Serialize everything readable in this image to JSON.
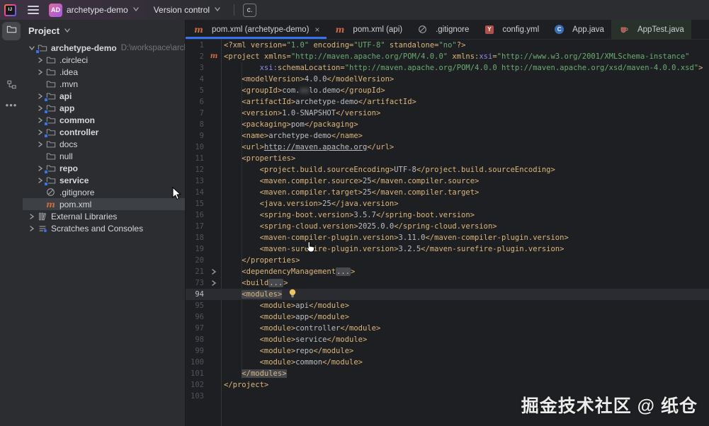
{
  "titlebar": {
    "project_badge": "AD",
    "project_name": "archetype-demo",
    "version_control_label": "Version control",
    "capture_badge": "c."
  },
  "stripe_icons": [
    "project-folder",
    "structure",
    "more-tool-windows"
  ],
  "project_panel": {
    "header": "Project",
    "tree": [
      {
        "label": "archetype-demo",
        "icon": "module-folder",
        "level": 0,
        "chevron": "expanded",
        "bold": true,
        "path": "D:\\workspace\\archetype-de"
      },
      {
        "label": ".circleci",
        "icon": "folder",
        "level": 1,
        "chevron": "collapsed"
      },
      {
        "label": ".idea",
        "icon": "folder",
        "level": 1,
        "chevron": "collapsed"
      },
      {
        "label": ".mvn",
        "icon": "folder",
        "level": 1,
        "chevron": "none"
      },
      {
        "label": "api",
        "icon": "module-folder",
        "level": 1,
        "chevron": "collapsed",
        "bold": true
      },
      {
        "label": "app",
        "icon": "module-folder",
        "level": 1,
        "chevron": "collapsed",
        "bold": true
      },
      {
        "label": "common",
        "icon": "module-folder",
        "level": 1,
        "chevron": "collapsed",
        "bold": true
      },
      {
        "label": "controller",
        "icon": "module-folder",
        "level": 1,
        "chevron": "collapsed",
        "bold": true
      },
      {
        "label": "docs",
        "icon": "folder",
        "level": 1,
        "chevron": "collapsed"
      },
      {
        "label": "null",
        "icon": "folder",
        "level": 1,
        "chevron": "none"
      },
      {
        "label": "repo",
        "icon": "module-folder",
        "level": 1,
        "chevron": "collapsed",
        "bold": true
      },
      {
        "label": "service",
        "icon": "module-folder",
        "level": 1,
        "chevron": "collapsed",
        "bold": true
      },
      {
        "label": ".gitignore",
        "icon": "ignored",
        "level": 1,
        "chevron": "none"
      },
      {
        "label": "pom.xml",
        "icon": "maven",
        "level": 1,
        "chevron": "none",
        "selected": true
      },
      {
        "label": "External Libraries",
        "icon": "libraries",
        "level": 0,
        "chevron": "collapsed"
      },
      {
        "label": "Scratches and Consoles",
        "icon": "scratches",
        "level": 0,
        "chevron": "collapsed"
      }
    ]
  },
  "tabs": [
    {
      "label": "pom.xml (archetype-demo)",
      "icon": "maven",
      "active": true,
      "closable": true
    },
    {
      "label": "pom.xml (api)",
      "icon": "maven"
    },
    {
      "label": ".gitignore",
      "icon": "ignored"
    },
    {
      "label": "config.yml",
      "icon": "yaml"
    },
    {
      "label": "App.java",
      "icon": "java-class"
    },
    {
      "label": "AppTest.java",
      "icon": "java-test",
      "tinted": true
    }
  ],
  "editor": {
    "lines": [
      {
        "n": "1",
        "seg": [
          [
            "tag",
            "<?xml version="
          ],
          [
            "str",
            "\"1.0\""
          ],
          [
            "tag",
            " encoding="
          ],
          [
            "str",
            "\"UTF-8\""
          ],
          [
            "tag",
            " standalone="
          ],
          [
            "str",
            "\"no\""
          ],
          [
            "tag",
            "?>"
          ]
        ]
      },
      {
        "n": "2",
        "g": "maven",
        "seg": [
          [
            "tag",
            "<project xmlns="
          ],
          [
            "str",
            "\"http://maven.apache.org/POM/4.0.0\""
          ],
          [
            "tag",
            " xmlns:"
          ],
          [
            "ns",
            "xsi"
          ],
          [
            "tag",
            "="
          ],
          [
            "str",
            "\"http://www.w3.org/2001/XMLSchema-instance\""
          ]
        ]
      },
      {
        "n": "3",
        "seg": [
          [
            "txt",
            "        "
          ],
          [
            "ns",
            "xsi:"
          ],
          [
            "tag",
            "schemaLocation="
          ],
          [
            "str",
            "\"http://maven.apache.org/POM/4.0.0 http://maven.apache.org/xsd/maven-4.0.0.xsd\""
          ],
          [
            "tag",
            ">"
          ]
        ]
      },
      {
        "n": "4",
        "seg": [
          [
            "txt",
            "    "
          ],
          [
            "tag",
            "<modelVersion>"
          ],
          [
            "txt",
            "4.0.0"
          ],
          [
            "tag",
            "</modelVersion>"
          ]
        ]
      },
      {
        "n": "5",
        "seg": [
          [
            "txt",
            "    "
          ],
          [
            "tag",
            "<groupId>"
          ],
          [
            "txt",
            "com."
          ],
          [
            "blur",
            "xx"
          ],
          [
            "txt",
            "lo.demo"
          ],
          [
            "tag",
            "</groupId>"
          ]
        ]
      },
      {
        "n": "6",
        "seg": [
          [
            "txt",
            "    "
          ],
          [
            "tag",
            "<artifactId>"
          ],
          [
            "txt",
            "archetype-demo"
          ],
          [
            "tag",
            "</artifactId>"
          ]
        ]
      },
      {
        "n": "7",
        "seg": [
          [
            "txt",
            "    "
          ],
          [
            "tag",
            "<version>"
          ],
          [
            "txt",
            "1.0-SNAPSHOT"
          ],
          [
            "tag",
            "</version>"
          ]
        ]
      },
      {
        "n": "8",
        "seg": [
          [
            "txt",
            "    "
          ],
          [
            "tag",
            "<packaging>"
          ],
          [
            "txt",
            "pom"
          ],
          [
            "tag",
            "</packaging>"
          ]
        ]
      },
      {
        "n": "9",
        "seg": [
          [
            "txt",
            "    "
          ],
          [
            "tag",
            "<name>"
          ],
          [
            "txt",
            "archetype-demo"
          ],
          [
            "tag",
            "</name>"
          ]
        ]
      },
      {
        "n": "10",
        "seg": [
          [
            "txt",
            "    "
          ],
          [
            "tag",
            "<url>"
          ],
          [
            "url",
            "http://maven.apache.org"
          ],
          [
            "tag",
            "</url>"
          ]
        ]
      },
      {
        "n": "11",
        "seg": [
          [
            "txt",
            "    "
          ],
          [
            "tag",
            "<properties>"
          ]
        ]
      },
      {
        "n": "12",
        "seg": [
          [
            "txt",
            "        "
          ],
          [
            "tag",
            "<project.build.sourceEncoding>"
          ],
          [
            "txt",
            "UTF-8"
          ],
          [
            "tag",
            "</project.build.sourceEncoding>"
          ]
        ]
      },
      {
        "n": "13",
        "seg": [
          [
            "txt",
            "        "
          ],
          [
            "tag",
            "<maven.compiler.source>"
          ],
          [
            "txt",
            "25"
          ],
          [
            "tag",
            "</maven.compiler.source>"
          ]
        ]
      },
      {
        "n": "14",
        "seg": [
          [
            "txt",
            "        "
          ],
          [
            "tag",
            "<maven.compiler.target>"
          ],
          [
            "txt",
            "25"
          ],
          [
            "tag",
            "</maven.compiler.target>"
          ]
        ]
      },
      {
        "n": "15",
        "seg": [
          [
            "txt",
            "        "
          ],
          [
            "tag",
            "<java.version>"
          ],
          [
            "txt",
            "25"
          ],
          [
            "tag",
            "</java.version>"
          ]
        ]
      },
      {
        "n": "16",
        "seg": [
          [
            "txt",
            "        "
          ],
          [
            "tag",
            "<spring-boot.version>"
          ],
          [
            "txt",
            "3.5.7"
          ],
          [
            "tag",
            "</spring-boot.version>"
          ]
        ]
      },
      {
        "n": "17",
        "seg": [
          [
            "txt",
            "        "
          ],
          [
            "tag",
            "<spring-cloud.version>"
          ],
          [
            "txt",
            "2025.0.0"
          ],
          [
            "tag",
            "</spring-cloud.version>"
          ]
        ]
      },
      {
        "n": "18",
        "seg": [
          [
            "txt",
            "        "
          ],
          [
            "tag",
            "<maven-compiler-plugin.version>"
          ],
          [
            "txt",
            "3.11.0"
          ],
          [
            "tag",
            "</maven-compiler-plugin.version>"
          ]
        ]
      },
      {
        "n": "19",
        "seg": [
          [
            "txt",
            "        "
          ],
          [
            "tag",
            "<maven-surefire-plugin.version>"
          ],
          [
            "txt",
            "3.2.5"
          ],
          [
            "tag",
            "</maven-surefire-plugin.version>"
          ]
        ]
      },
      {
        "n": "20",
        "seg": [
          [
            "txt",
            "    "
          ],
          [
            "tag",
            "</properties>"
          ]
        ]
      },
      {
        "n": "21",
        "g": "fold",
        "seg": [
          [
            "txt",
            "    "
          ],
          [
            "tag",
            "<dependencyManagement"
          ],
          [
            "fold",
            "..."
          ],
          [
            "tag",
            ">"
          ]
        ]
      },
      {
        "n": "73",
        "g": "fold",
        "seg": [
          [
            "txt",
            "    "
          ],
          [
            "tag",
            "<build"
          ],
          [
            "fold",
            "..."
          ],
          [
            "tag",
            ">"
          ]
        ]
      },
      {
        "n": "94",
        "caret": true,
        "seg": [
          [
            "txt",
            "    "
          ],
          [
            "hltag",
            "<modules>"
          ],
          [
            "bulb",
            ""
          ]
        ]
      },
      {
        "n": "95",
        "seg": [
          [
            "txt",
            "        "
          ],
          [
            "tag",
            "<module>"
          ],
          [
            "txt",
            "api"
          ],
          [
            "tag",
            "</module>"
          ]
        ]
      },
      {
        "n": "96",
        "seg": [
          [
            "txt",
            "        "
          ],
          [
            "tag",
            "<module>"
          ],
          [
            "txt",
            "app"
          ],
          [
            "tag",
            "</module>"
          ]
        ]
      },
      {
        "n": "97",
        "seg": [
          [
            "txt",
            "        "
          ],
          [
            "tag",
            "<module>"
          ],
          [
            "txt",
            "controller"
          ],
          [
            "tag",
            "</module>"
          ]
        ]
      },
      {
        "n": "98",
        "seg": [
          [
            "txt",
            "        "
          ],
          [
            "tag",
            "<module>"
          ],
          [
            "txt",
            "service"
          ],
          [
            "tag",
            "</module>"
          ]
        ]
      },
      {
        "n": "99",
        "seg": [
          [
            "txt",
            "        "
          ],
          [
            "tag",
            "<module>"
          ],
          [
            "txt",
            "repo"
          ],
          [
            "tag",
            "</module>"
          ]
        ]
      },
      {
        "n": "100",
        "seg": [
          [
            "txt",
            "        "
          ],
          [
            "tag",
            "<module>"
          ],
          [
            "txt",
            "common"
          ],
          [
            "tag",
            "</module>"
          ]
        ]
      },
      {
        "n": "101",
        "seg": [
          [
            "txt",
            "    "
          ],
          [
            "hltag",
            "</modules>"
          ]
        ]
      },
      {
        "n": "102",
        "seg": [
          [
            "tag",
            "</project>"
          ]
        ]
      },
      {
        "n": "103",
        "seg": []
      }
    ]
  },
  "watermark": "掘金技术社区 @ 纸仓",
  "colors": {
    "accent": "#3574f0",
    "tag": "#dcb67a",
    "string": "#6aab73",
    "namespace": "#9089e8",
    "text": "#bcbec4",
    "maven_orange": "#cf6b3f",
    "caret_line": "#2a2c31"
  }
}
